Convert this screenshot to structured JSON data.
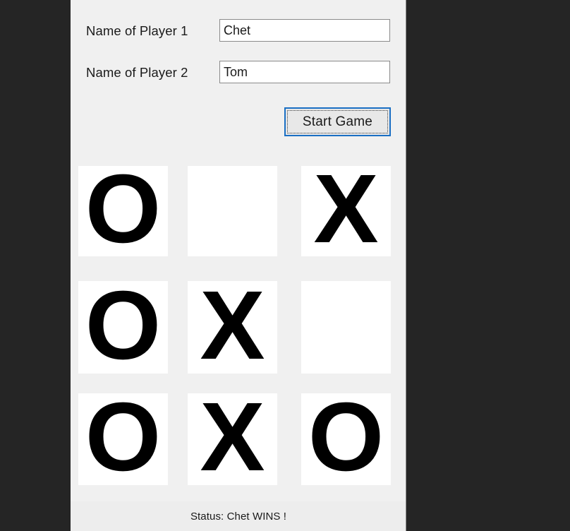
{
  "window": {
    "background_color": "#f0f0f0",
    "desktop_color": "#252525"
  },
  "form": {
    "player1": {
      "label": "Name of Player 1",
      "value": "Chet",
      "placeholder": ""
    },
    "player2": {
      "label": "Name of Player 2",
      "value": "Tom",
      "placeholder": ""
    },
    "start_button": {
      "label": "Start Game",
      "focused": true,
      "focus_border_color": "#1a6fc4"
    }
  },
  "board": {
    "cells": [
      {
        "index": 0,
        "mark": "O",
        "row": 0,
        "col": 0
      },
      {
        "index": 1,
        "mark": "",
        "row": 0,
        "col": 1
      },
      {
        "index": 2,
        "mark": "X",
        "row": 0,
        "col": 2
      },
      {
        "index": 3,
        "mark": "O",
        "row": 1,
        "col": 0
      },
      {
        "index": 4,
        "mark": "X",
        "row": 1,
        "col": 1
      },
      {
        "index": 5,
        "mark": "",
        "row": 1,
        "col": 2
      },
      {
        "index": 6,
        "mark": "O",
        "row": 2,
        "col": 0
      },
      {
        "index": 7,
        "mark": "X",
        "row": 2,
        "col": 1
      },
      {
        "index": 8,
        "mark": "O",
        "row": 2,
        "col": 2
      }
    ],
    "cell_background": "#ffffff",
    "mark_color": "#000000"
  },
  "status": {
    "text": "Status: Chet WINS !"
  }
}
